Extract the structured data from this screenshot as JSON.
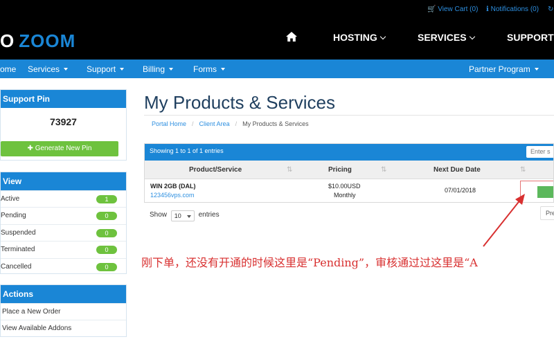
{
  "header": {
    "utility": {
      "cart": "View Cart (0)",
      "notifications": "Notifications (0)"
    },
    "logo": {
      "part1": "O",
      "part2": "ZOOM"
    },
    "main_nav": [
      {
        "label": "HOSTING",
        "icon": "chevron-down-icon"
      },
      {
        "label": "SERVICES",
        "icon": "chevron-down-icon"
      },
      {
        "label": "SUPPORT"
      }
    ],
    "home_icon": "home-icon"
  },
  "subnav": {
    "items": [
      {
        "label": "ome"
      },
      {
        "label": "Services"
      },
      {
        "label": "Support"
      },
      {
        "label": "Billing"
      },
      {
        "label": "Forms"
      }
    ],
    "right": {
      "label": "Partner Program"
    }
  },
  "sidebar": {
    "support_pin": {
      "title": "Support Pin",
      "value": "73927",
      "button": "Generate New Pin"
    },
    "view": {
      "title": "View",
      "items": [
        {
          "label": "Active",
          "count": "1"
        },
        {
          "label": "Pending",
          "count": "0"
        },
        {
          "label": "Suspended",
          "count": "0"
        },
        {
          "label": "Terminated",
          "count": "0"
        },
        {
          "label": "Cancelled",
          "count": "0"
        }
      ]
    },
    "actions": {
      "title": "Actions",
      "items": [
        {
          "label": "Place a New Order"
        },
        {
          "label": "View Available Addons"
        }
      ]
    }
  },
  "main": {
    "title": "My Products & Services",
    "breadcrumb": [
      "Portal Home",
      "Client Area",
      "My Products & Services"
    ],
    "table": {
      "info": "Showing 1 to 1 of 1 entries",
      "search_placeholder": "Enter s",
      "columns": [
        "Product/Service",
        "Pricing",
        "Next Due Date"
      ],
      "rows": [
        {
          "product": "WIN 2GB (DAL)",
          "domain": "123456vps.com",
          "price": "$10.00USD",
          "cycle": "Monthly",
          "due": "07/01/2018",
          "status_color": "#5cb85c"
        }
      ]
    },
    "pagination": {
      "show_label": "Show",
      "entries_value": "10",
      "entries_label": "entries",
      "prev": "Pre"
    }
  },
  "annotation": {
    "text": "刚下单，还没有开通的时候这里是“Pending”，审核通过过这里是“A",
    "color": "#d83030"
  }
}
